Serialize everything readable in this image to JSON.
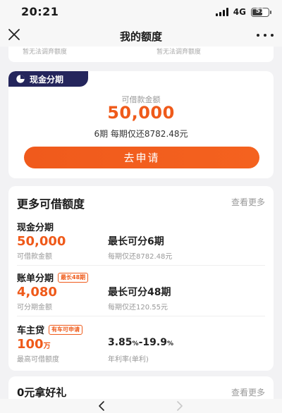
{
  "status_bar": {
    "time": "20:21",
    "network": "4G",
    "battery": "51"
  },
  "nav": {
    "title": "我的额度"
  },
  "peek": {
    "left_text": "暂无法调弃额度",
    "right_text": "暂无法调弃额度"
  },
  "featured": {
    "tag": "现金分期",
    "subtitle": "可借款金额",
    "amount": "50,000",
    "desc": "6期  每期仅还8782.48元",
    "button": "去申请"
  },
  "more": {
    "title": "更多可借额度",
    "see_more": "查看更多",
    "items": [
      {
        "name": "现金分期",
        "badge": "",
        "value": "50,000",
        "unit": "",
        "value_sub": "可借款金额",
        "right": "最长可分6期",
        "right_unit": "",
        "right_sub": "每期仅还8782.48元"
      },
      {
        "name": "账单分期",
        "badge": "最长48期",
        "value": "4,080",
        "unit": "",
        "value_sub": "可分期金额",
        "right": "最长可分48期",
        "right_unit": "",
        "right_sub": "每期仅还120.55元"
      },
      {
        "name": "车主贷",
        "badge": "有车可申请",
        "value": "100",
        "unit": "万",
        "value_sub": "最高可借额度",
        "right": "3.85",
        "right_mid_unit": "%",
        "right_tail": "-19.9",
        "right_unit": "%",
        "right_sub": "年利率(单利)"
      }
    ]
  },
  "bottom_section": {
    "title": "0元拿好礼",
    "see_more": "查看更多"
  },
  "colors": {
    "accent": "#ef5a1a",
    "tag_bg": "#24255c"
  }
}
